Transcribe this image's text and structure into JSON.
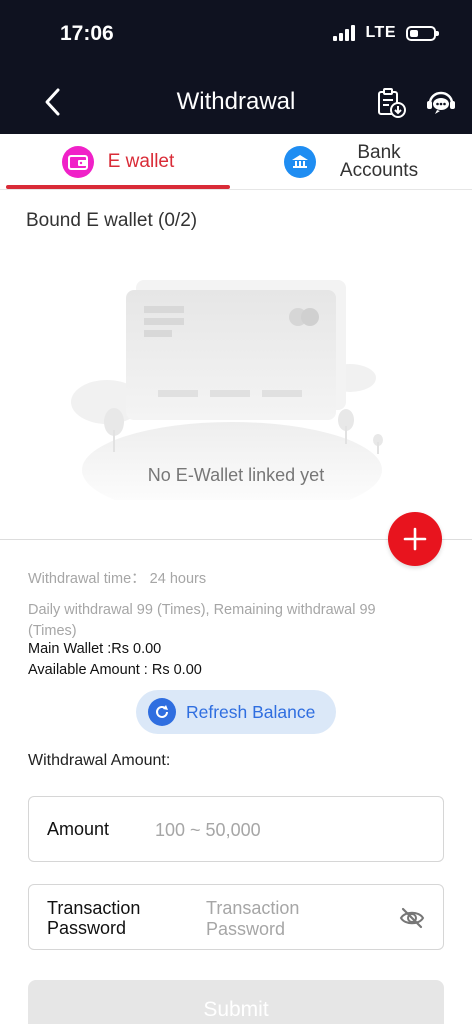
{
  "status_bar": {
    "time": "17:06",
    "network": "LTE"
  },
  "header": {
    "title": "Withdrawal",
    "icons": [
      "back-icon",
      "withdraw-record-icon",
      "customer-service-icon"
    ]
  },
  "tabs": [
    {
      "label": "E wallet",
      "active": true,
      "icon": "ewallet-icon"
    },
    {
      "label": "Bank Accounts",
      "active": false,
      "icon": "bank-icon"
    }
  ],
  "bound": {
    "title": "Bound E wallet (0/2)",
    "empty_text": "No E-Wallet linked yet"
  },
  "info": {
    "withdrawal_time": "Withdrawal time： 24 hours",
    "daily_limit": "Daily withdrawal 99 (Times), Remaining withdrawal 99 (Times)",
    "main_wallet": "Main Wallet :Rs 0.00",
    "available": "Available Amount : Rs 0.00"
  },
  "refresh": {
    "label": "Refresh Balance"
  },
  "form": {
    "section_title": "Withdrawal Amount:",
    "amount_label": "Amount",
    "amount_placeholder": "100 ~ 50,000",
    "password_label_line1": "Transaction",
    "password_label_line2": "Password",
    "password_placeholder_line1": "Transaction",
    "password_placeholder_line2": "Password",
    "submit_label": "Submit"
  },
  "colors": {
    "accent": "#d92b37",
    "add_button": "#e8141e",
    "topbar": "#0f1220",
    "refresh": "#2f6ee0"
  }
}
